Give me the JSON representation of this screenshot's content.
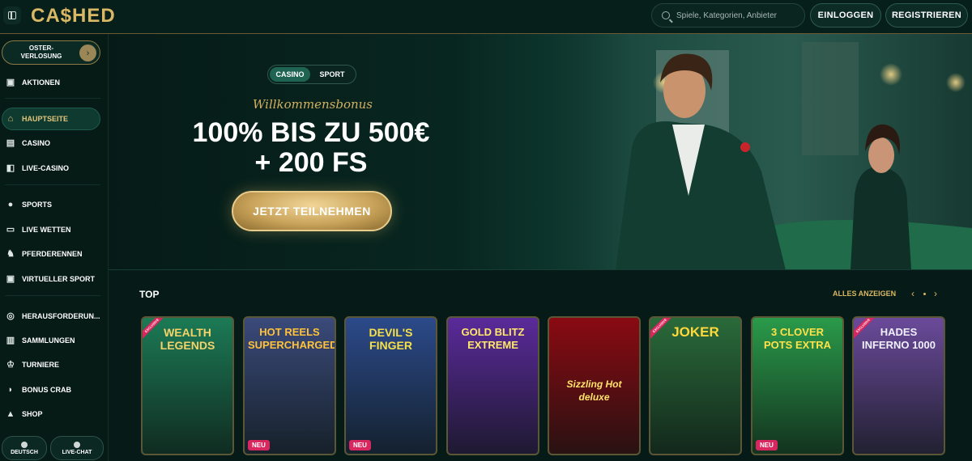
{
  "header": {
    "logo": "CA$HED",
    "search_placeholder": "Spiele, Kategorien, Anbieter",
    "login_label": "EINLOGGEN",
    "register_label": "REGISTRIEREN"
  },
  "sidebar": {
    "promo_label": "OSTER-\nVERLOSUNG",
    "items": [
      {
        "label": "AKTIONEN",
        "icon": "gift-icon"
      },
      {
        "label": "HAUPTSEITE",
        "icon": "home-icon"
      },
      {
        "label": "CASINO",
        "icon": "slot-machine-icon"
      },
      {
        "label": "LIVE-CASINO",
        "icon": "cards-icon"
      },
      {
        "label": "SPORTS",
        "icon": "ball-icon"
      },
      {
        "label": "LIVE WETTEN",
        "icon": "live-icon"
      },
      {
        "label": "PFERDERENNEN",
        "icon": "horse-icon"
      },
      {
        "label": "VIRTUELLER SPORT",
        "icon": "virtual-icon"
      },
      {
        "label": "HERAUSFORDERUN...",
        "icon": "challenge-icon"
      },
      {
        "label": "SAMMLUNGEN",
        "icon": "collection-icon"
      },
      {
        "label": "TURNIERE",
        "icon": "trophy-icon"
      },
      {
        "label": "BONUS CRAB",
        "icon": "crab-icon"
      },
      {
        "label": "SHOP",
        "icon": "shop-icon"
      }
    ],
    "language_label": "DEUTSCH",
    "livechat_label": "LIVE-CHAT"
  },
  "hero": {
    "tab_casino": "CASINO",
    "tab_sport": "SPORT",
    "subtitle": "Willkommensbonus",
    "headline_1": "100% BIS ZU 500€",
    "headline_2": "+ 200 FS",
    "cta_label": "JETZT TEILNEHMEN"
  },
  "top_section": {
    "title": "TOP",
    "see_all_label": "ALLES ANZEIGEN",
    "games": [
      {
        "title": "WEALTH LEGENDS",
        "badge": "",
        "ribbon": "EXCLUSIVE",
        "bg": "#1c7a55"
      },
      {
        "title": "HOT REELS SUPERCHARGED",
        "badge": "NEU",
        "ribbon": "",
        "bg": "#3a4a7a"
      },
      {
        "title": "DEVIL'S FINGER",
        "badge": "NEU",
        "ribbon": "",
        "bg": "#2c4a8a"
      },
      {
        "title": "GOLD BLITZ EXTREME",
        "badge": "",
        "ribbon": "",
        "bg": "#5a2a9a"
      },
      {
        "title": "Sizzling Hot deluxe",
        "badge": "",
        "ribbon": "",
        "bg": "#8a0a12"
      },
      {
        "title": "JOKER",
        "badge": "",
        "ribbon": "EXCLUSIVE",
        "bg": "#2a6a3a"
      },
      {
        "title": "3 CLOVER POTS EXTRA",
        "badge": "NEU",
        "ribbon": "",
        "bg": "#2a9a4a"
      },
      {
        "title": "HADES INFERNO 1000",
        "badge": "",
        "ribbon": "EXCLUSIVE",
        "bg": "#6a4a9a"
      }
    ]
  }
}
